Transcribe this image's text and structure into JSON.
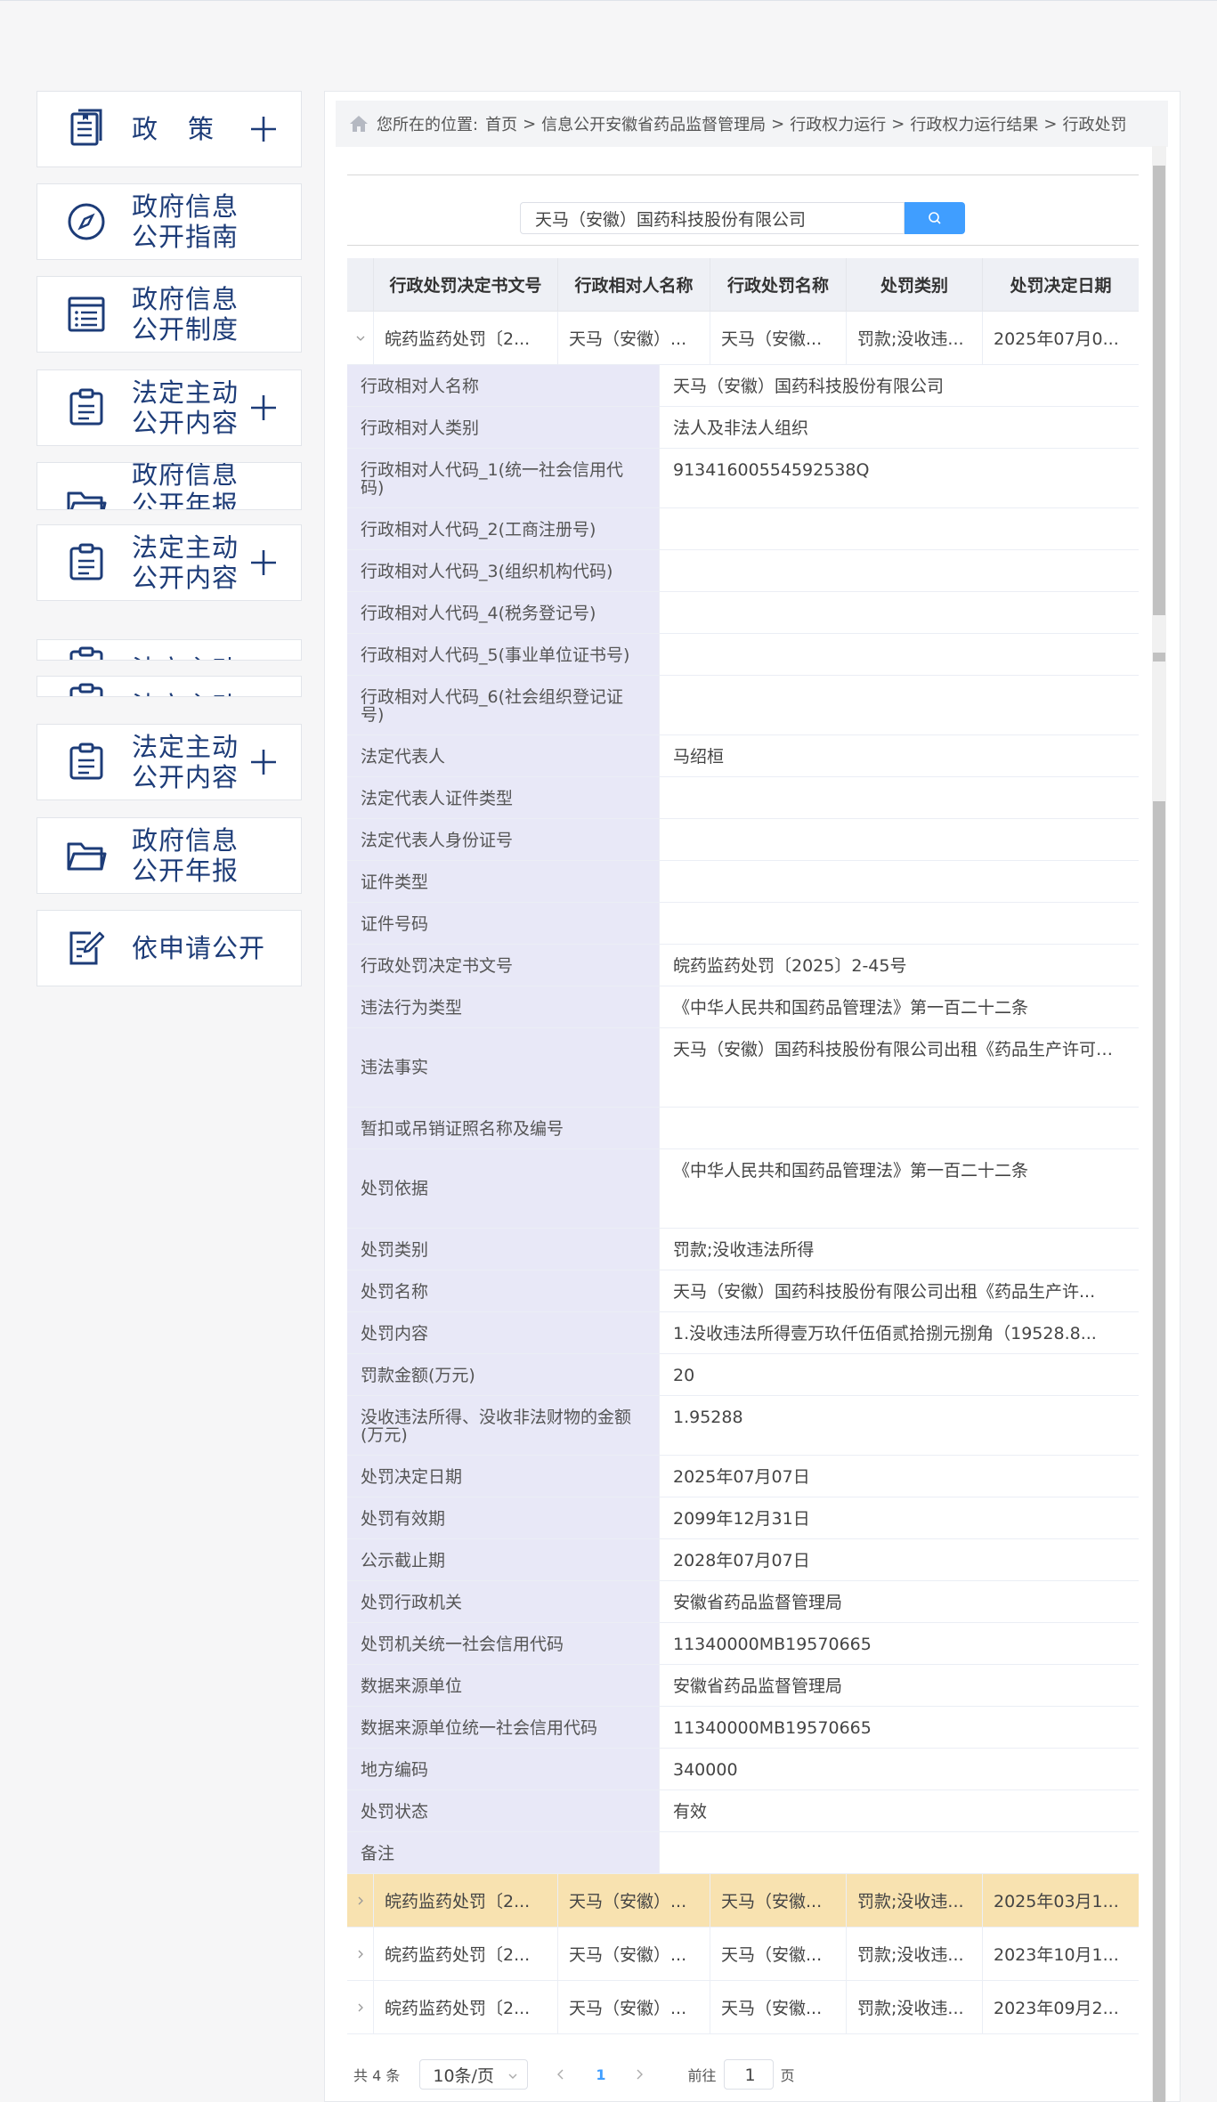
{
  "sidebar": {
    "items": [
      {
        "label": "政策",
        "icon": "book-icon",
        "expandable": true
      },
      {
        "label": "政府信息\n公开指南",
        "icon": "compass-icon",
        "expandable": false
      },
      {
        "label": "政府信息\n公开制度",
        "icon": "list-document-icon",
        "expandable": false
      },
      {
        "label": "法定主动\n公开内容",
        "icon": "clipboard-icon",
        "expandable": true
      },
      {
        "label": "政府信息\n公开年报",
        "icon": "folder-icon",
        "expandable": false
      },
      {
        "label": "法定主动\n公开内容",
        "icon": "clipboard-icon",
        "expandable": true
      },
      {
        "label": "法定主动",
        "icon": "clipboard-icon",
        "expandable": false
      },
      {
        "label": "法定主动",
        "icon": "clipboard-icon",
        "expandable": false
      },
      {
        "label": "法定主动\n公开内容",
        "icon": "clipboard-icon",
        "expandable": true
      },
      {
        "label": "政府信息\n公开年报",
        "icon": "folder-icon",
        "expandable": false
      },
      {
        "label": "依申请公开",
        "icon": "edit-form-icon",
        "expandable": false
      }
    ]
  },
  "breadcrumb": {
    "prefix": "您所在的位置:",
    "items": [
      "首页",
      "信息公开安徽省药品监督管理局",
      "行政权力运行",
      "行政权力运行结果",
      "行政处罚"
    ],
    "separator": ">"
  },
  "search": {
    "value": "天马（安徽）国药科技股份有限公司"
  },
  "table": {
    "headers": [
      "行政处罚决定书文号",
      "行政相对人名称",
      "行政处罚名称",
      "处罚类别",
      "处罚决定日期"
    ],
    "rows": [
      {
        "cells": [
          "皖药监药处罚〔2025〕2-45号",
          "天马（安徽）国药科技股份有限公司",
          "天马（安徽）国药科技股份有限公司出租",
          "罚款;没收违法所得",
          "2025年07月07日"
        ],
        "expanded": true,
        "highlighted": false
      },
      {
        "cells": [
          "皖药监药处罚〔2...",
          "天马（安徽）...",
          "天马（安徽...",
          "罚款;没收违...",
          "2025年03月1..."
        ],
        "expanded": false,
        "highlighted": true
      },
      {
        "cells": [
          "皖药监药处罚〔2...",
          "天马（安徽）...",
          "天马（安徽...",
          "罚款;没收违...",
          "2023年10月1..."
        ],
        "expanded": false,
        "highlighted": false
      },
      {
        "cells": [
          "皖药监药处罚〔2...",
          "天马（安徽）...",
          "天马（安徽...",
          "罚款;没收违...",
          "2023年09月2..."
        ],
        "expanded": false,
        "highlighted": false
      }
    ],
    "first_row_display": [
      "皖药监药处罚〔2...",
      "天马（安徽）...",
      "天马（安徽...",
      "罚款;没收违...",
      "2025年07月0..."
    ]
  },
  "detail": [
    {
      "k": "行政相对人名称",
      "v": "天马（安徽）国药科技股份有限公司"
    },
    {
      "k": "行政相对人类别",
      "v": "法人及非法人组织"
    },
    {
      "k": "行政相对人代码_1(统一社会信用代码)",
      "v": "91341600554592538Q"
    },
    {
      "k": "行政相对人代码_2(工商注册号)",
      "v": ""
    },
    {
      "k": "行政相对人代码_3(组织机构代码)",
      "v": ""
    },
    {
      "k": "行政相对人代码_4(税务登记号)",
      "v": ""
    },
    {
      "k": "行政相对人代码_5(事业单位证书号)",
      "v": ""
    },
    {
      "k": "行政相对人代码_6(社会组织登记证号)",
      "v": ""
    },
    {
      "k": "法定代表人",
      "v": "马绍桓"
    },
    {
      "k": "法定代表人证件类型",
      "v": ""
    },
    {
      "k": "法定代表人身份证号",
      "v": ""
    },
    {
      "k": "证件类型",
      "v": ""
    },
    {
      "k": "证件号码",
      "v": ""
    },
    {
      "k": "行政处罚决定书文号",
      "v": "皖药监药处罚〔2025〕2-45号"
    },
    {
      "k": "违法行为类型",
      "v": "《中华人民共和国药品管理法》第一百二十二条"
    },
    {
      "k": "违法事实",
      "v": "天马（安徽）国药科技股份有限公司出租《药品生产许可证》"
    },
    {
      "k": "暂扣或吊销证照名称及编号",
      "v": ""
    },
    {
      "k": "处罚依据",
      "v": "《中华人民共和国药品管理法》第一百二十二条"
    },
    {
      "k": "处罚类别",
      "v": "罚款;没收违法所得"
    },
    {
      "k": "处罚名称",
      "v": "天马（安徽）国药科技股份有限公司出租《药品生产许..."
    },
    {
      "k": "处罚内容",
      "v": "1.没收违法所得壹万玖仟伍佰贰拾捌元捌角（19528.8..."
    },
    {
      "k": "罚款金额(万元)",
      "v": "20"
    },
    {
      "k": "没收违法所得、没收非法财物的金额(万元)",
      "v": "1.95288"
    },
    {
      "k": "处罚决定日期",
      "v": "2025年07月07日"
    },
    {
      "k": "处罚有效期",
      "v": "2099年12月31日"
    },
    {
      "k": "公示截止期",
      "v": "2028年07月07日"
    },
    {
      "k": "处罚行政机关",
      "v": "安徽省药品监督管理局"
    },
    {
      "k": "处罚机关统一社会信用代码",
      "v": "11340000MB19570665"
    },
    {
      "k": "数据来源单位",
      "v": "安徽省药品监督管理局"
    },
    {
      "k": "数据来源单位统一社会信用代码",
      "v": "11340000MB19570665"
    },
    {
      "k": "地方编码",
      "v": "340000"
    },
    {
      "k": "处罚状态",
      "v": "有效"
    },
    {
      "k": "备注",
      "v": ""
    }
  ],
  "pagination": {
    "total": "共 4 条",
    "page_size": "10条/页",
    "current_page": "1",
    "goto_label": "前往",
    "goto_value": "1",
    "page_suffix": "页"
  },
  "colors": {
    "brand": "#1d3c78",
    "accent": "#409eff",
    "highlight_row": "#f8e2b0",
    "detail_key_bg": "#e8e8f7"
  }
}
